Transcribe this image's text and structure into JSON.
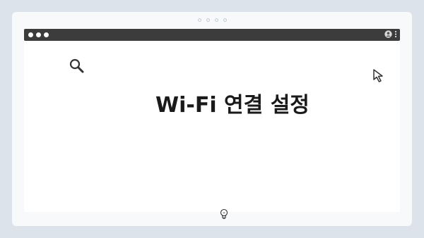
{
  "window": {
    "title_text": "Wi-Fi 연결 설정"
  },
  "icons": {
    "search": "search-icon",
    "cursor": "cursor-icon",
    "bulb": "lightbulb-icon",
    "user": "user-icon",
    "menu": "more-vertical-icon"
  },
  "colors": {
    "background": "#dde3ea",
    "card": "#f8f9fa",
    "titlebar": "#3c3c3c",
    "content": "#ffffff",
    "title_text": "#1a1a1a"
  }
}
